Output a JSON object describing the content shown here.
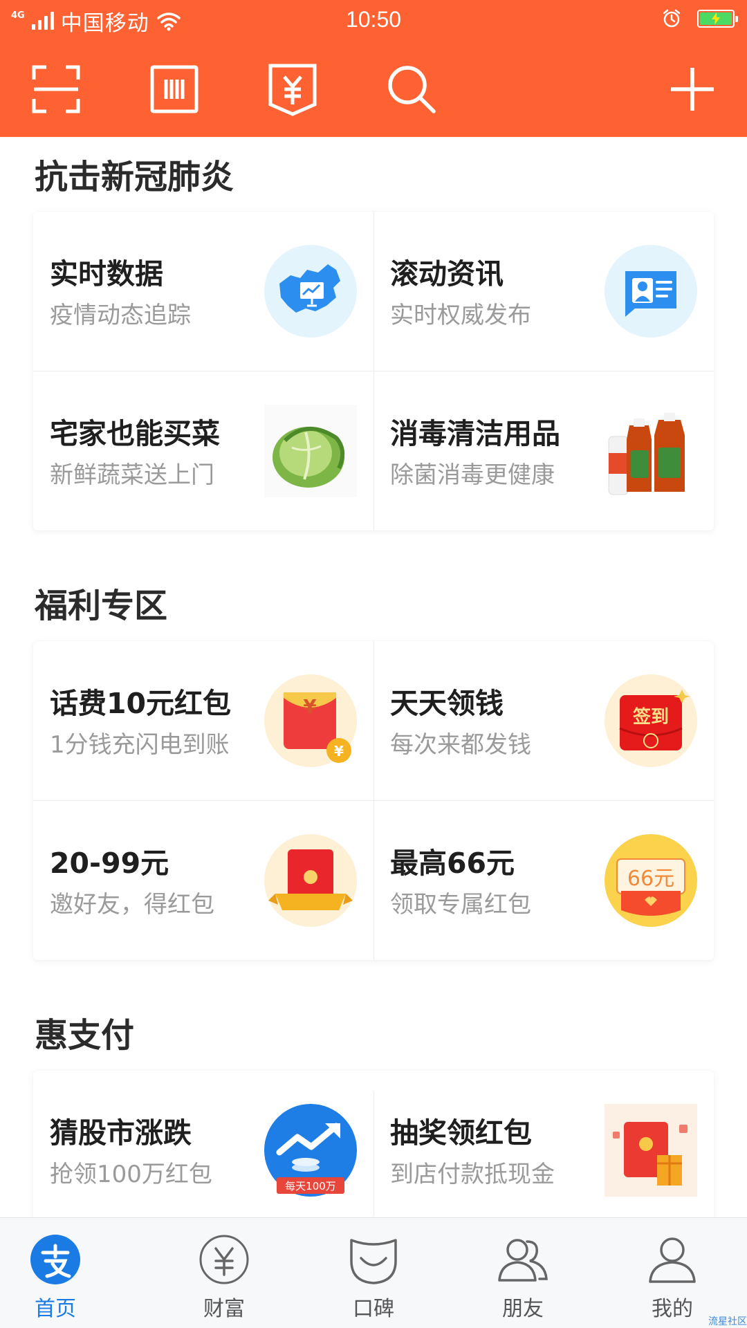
{
  "status_bar": {
    "network": "4G",
    "carrier": "中国移动",
    "time": "10:50",
    "icons": [
      "signal-icon",
      "wifi-icon",
      "alarm-icon",
      "battery-charging-icon"
    ]
  },
  "top_bar": {
    "background_color": "#fe6232",
    "actions": [
      "scan-icon",
      "barcode-pay-icon",
      "receive-money-icon",
      "search-icon",
      "add-icon"
    ]
  },
  "sections": [
    {
      "title": "抗击新冠肺炎",
      "items": [
        {
          "title": "实时数据",
          "subtitle": "疫情动态追踪",
          "icon": "china-map-icon"
        },
        {
          "title": "滚动资讯",
          "subtitle": "实时权威发布",
          "icon": "news-card-icon"
        },
        {
          "title": "宅家也能买菜",
          "subtitle": "新鲜蔬菜送上门",
          "icon": "cabbage-image"
        },
        {
          "title": "消毒清洁用品",
          "subtitle": "除菌消毒更健康",
          "icon": "disinfectant-bottles-image"
        }
      ]
    },
    {
      "title": "福利专区",
      "items": [
        {
          "title": "话费10元红包",
          "subtitle": "1分钱充闪电到账",
          "icon": "phone-red-packet-icon"
        },
        {
          "title": "天天领钱",
          "subtitle": "每次来都发钱",
          "icon": "checkin-red-packet-icon",
          "icon_text": "签到"
        },
        {
          "title": "20-99元",
          "subtitle": "邀好友，得红包",
          "icon": "invite-red-packet-icon"
        },
        {
          "title": "最高66元",
          "subtitle": "领取专属红包",
          "icon": "coupon-66-icon",
          "icon_text": "66元"
        }
      ]
    },
    {
      "title": "惠支付",
      "items": [
        {
          "title": "猜股市涨跌",
          "subtitle": "抢领100万红包",
          "icon": "stock-trend-icon",
          "icon_text": "每天100万"
        },
        {
          "title": "抽奖领红包",
          "subtitle": "到店付款抵现金",
          "icon": "lottery-red-packet-icon"
        }
      ]
    }
  ],
  "bottom_nav": [
    {
      "label": "首页",
      "icon": "alipay-home-icon",
      "active": true
    },
    {
      "label": "财富",
      "icon": "wealth-yuan-icon",
      "active": false
    },
    {
      "label": "口碑",
      "icon": "koubei-smile-icon",
      "active": false
    },
    {
      "label": "朋友",
      "icon": "friends-icon",
      "active": false
    },
    {
      "label": "我的",
      "icon": "profile-icon",
      "active": false
    }
  ],
  "watermark": "流星社区",
  "colors": {
    "accent": "#fe6232",
    "active_tab": "#1a7be5",
    "subtitle": "#9a9a9a"
  }
}
